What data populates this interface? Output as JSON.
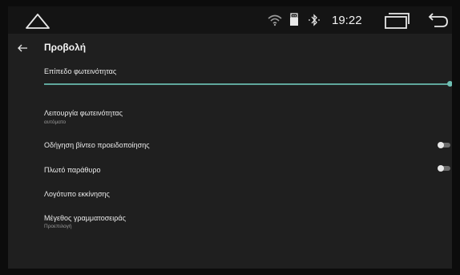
{
  "statusbar": {
    "time": "19:22",
    "icons": [
      "home-icon",
      "wifi-icon",
      "usb-icon",
      "bluetooth-icon",
      "recent-apps-icon",
      "back-icon"
    ]
  },
  "header": {
    "title": "Προβολή",
    "back_icon": "arrow-left-icon"
  },
  "settings": {
    "brightness_level": {
      "label": "Επίπεδο φωτεινότητας",
      "value_fraction": 1.0
    },
    "brightness_mode": {
      "label": "Λειτουργία φωτεινότητας",
      "value": "αυτόματο"
    },
    "warning_video": {
      "label": "Οδήγηση βίντεο προειδοποίησης",
      "enabled": false
    },
    "wide_window": {
      "label": "Πλωτό παράθυρο",
      "enabled": false
    },
    "boot_logo": {
      "label": "Λογότυπο εκκίνησης"
    },
    "font_size": {
      "label": "Μέγεθος γραμματοσειράς",
      "value": "Προεπιλογή"
    }
  },
  "colors": {
    "accent": "#6fc0b4",
    "background": "#1f1f1f",
    "statusbar": "#141414"
  }
}
